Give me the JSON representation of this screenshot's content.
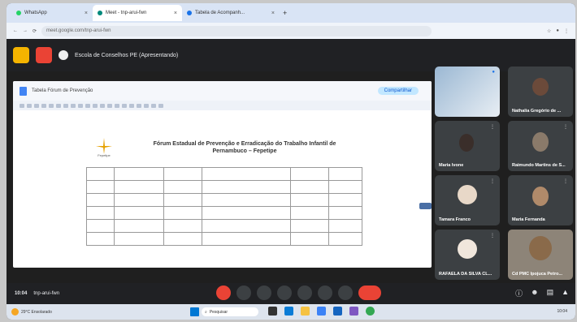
{
  "browser": {
    "tabs": [
      {
        "label": "WhatsApp",
        "color": "#25d366",
        "active": false
      },
      {
        "label": "Meet - tnp-arui-fwn",
        "color": "#00897b",
        "active": true
      },
      {
        "label": "Tabela de Acompanh...",
        "color": "#1a73e8",
        "active": false
      }
    ],
    "url": "meet.google.com/tnp-arui-fwn"
  },
  "meeting": {
    "title": "Escola de Conselhos PE (Apresentando)",
    "time": "10:04",
    "code": "tnp-arui-fwn"
  },
  "document": {
    "title": "Tabela Fórum de Prevenção",
    "share_label": "Compartilhar",
    "heading_line1": "Fórum Estadual de Prevenção e Erradicação do Trabalho Infantil de",
    "heading_line2": "Pernambuco – Fepetipe",
    "logo_label": "Fepetipe"
  },
  "participants": [
    {
      "name": "",
      "avatar_color": "#9bb8d3"
    },
    {
      "name": "Nathalia Gregório de ...",
      "avatar_color": "#6b4a3a"
    },
    {
      "name": "Maria Ivone",
      "avatar_color": "#3a2e2a"
    },
    {
      "name": "Raimundo Martins de S...",
      "avatar_color": "#8a7a6a"
    },
    {
      "name": "Tamara Franco",
      "avatar_color": "#e8d8c8"
    },
    {
      "name": "Maria Fernanda",
      "avatar_color": "#b08a6a"
    },
    {
      "name": "RAFAELA DA SILVA CL...",
      "avatar_color": "#f0e6dc"
    },
    {
      "name": "Cd PMC Ipojuca Petro...",
      "avatar_color": "#8a6a4a"
    }
  ],
  "taskbar": {
    "weather": "29°C Ensolarado",
    "search": "Pesquisar",
    "clock": "10:04"
  }
}
